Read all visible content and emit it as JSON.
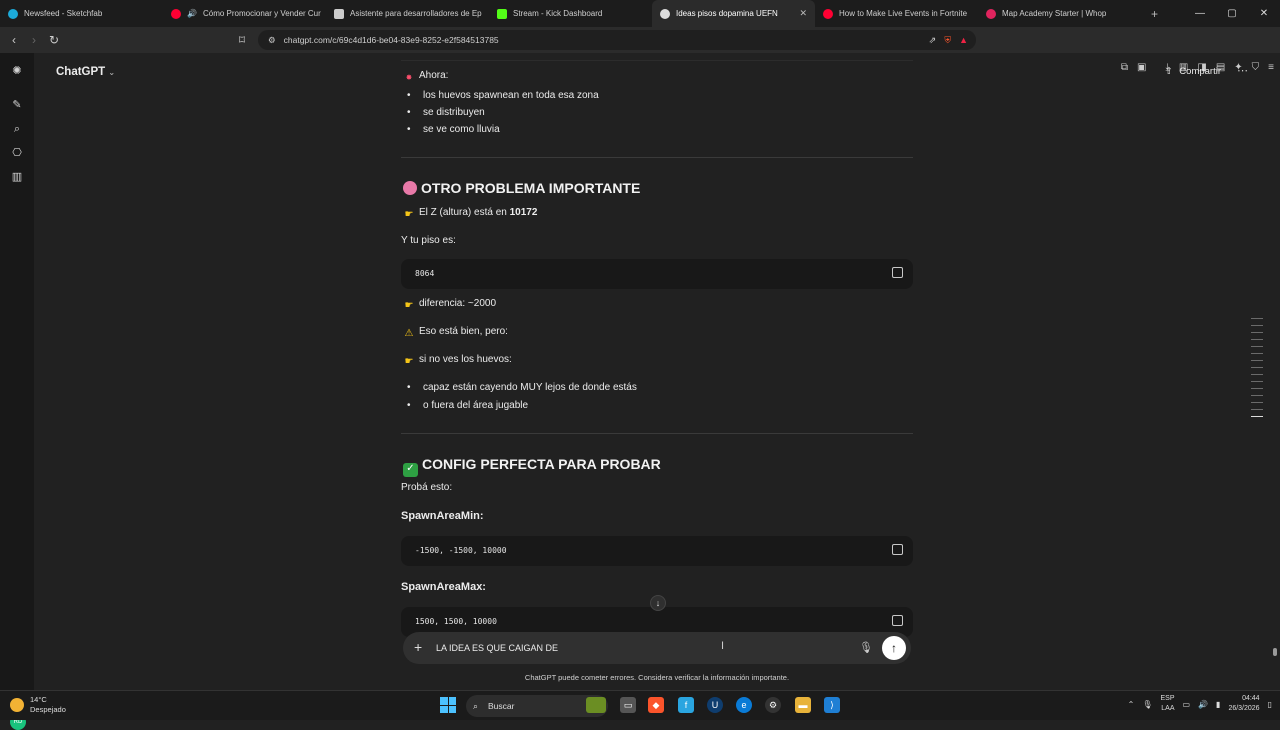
{
  "browser": {
    "tabs": [
      {
        "title": "Newsfeed - Sketchfab",
        "color": "#1caad9",
        "active": false
      },
      {
        "title": "Cómo Promocionar y Vender Cur",
        "color": "#ff0033",
        "active": false
      },
      {
        "title": "Asistente para desarrolladores de Ep",
        "color": "#cccccc",
        "active": false
      },
      {
        "title": "Stream - Kick Dashboard",
        "color": "#53fc18",
        "active": false
      },
      {
        "title": "Ideas pisos dopamina UEFN",
        "color": "#dddddd",
        "active": true
      },
      {
        "title": "How to Make Live Events in Fortnite",
        "color": "#ff0033",
        "active": false
      },
      {
        "title": "Map Academy Starter | Whop",
        "color": "#e0245e",
        "active": false
      }
    ],
    "tab_close": "✕",
    "new_tab": "+",
    "url": "chatgpt.com/c/69c4d1d6-be04-83e9-8252-e2f584513785"
  },
  "app": {
    "brand": "ChatGPT",
    "share": "Compartir"
  },
  "chat": {
    "now_label": "Ahora:",
    "now_items": [
      "los huevos spawnean en toda esa zona",
      "se distribuyen",
      "se ve como lluvia"
    ],
    "problem_heading": "OTRO PROBLEMA IMPORTANTE",
    "z_prefix": "El Z (altura) está en ",
    "z_value": "10172",
    "floor_label": "Y tu piso es:",
    "floor_code": "8064",
    "difference": "diferencia: ~2000",
    "warning": "Eso está bien, pero:",
    "if_not": "si no ves los huevos:",
    "if_not_items": [
      "capaz están cayendo MUY lejos de donde estás",
      "o fuera del área jugable"
    ],
    "config_heading": "CONFIG PERFECTA PARA PROBAR",
    "try_label": "Probá esto:",
    "min_label": "SpawnAreaMin:",
    "min_code": "-1500, -1500, 10000",
    "max_label": "SpawnAreaMax:",
    "max_code": "1500, 1500, 10000"
  },
  "composer": {
    "text": "LA IDEA ES QUE CAIGAN DE",
    "disclaimer": "ChatGPT puede cometer errores. Considera verificar la información importante."
  },
  "taskbar": {
    "temp": "14°C",
    "weather": "Despejado",
    "search": "Buscar",
    "lang": "ESP",
    "region": "LAA",
    "time": "04:44",
    "date": "26/3/2026"
  }
}
